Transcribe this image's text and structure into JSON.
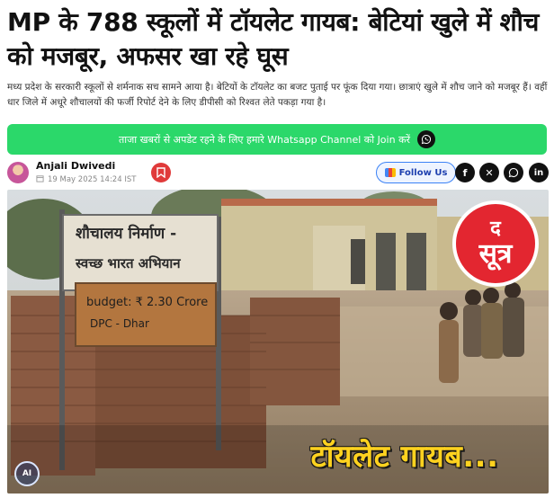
{
  "article": {
    "headline": "MP के 788 स्कूलों में टॉयलेट गायब: बेटियां खुले में शौच को मजबूर, अफसर खा रहे घूस",
    "summary": "मध्य प्रदेश के सरकारी स्कूलों से शर्मनाक सच सामने आया है। बेटियों के टॉयलेट का बजट पुताई पर फूंक दिया गया। छात्राएं खुले में शौच जाने को मजबूर हैं। वहीं धार जिले में अधूरे शौचालयों की फर्जी रिपोर्ट देने के लिए डीपीसी को रिश्वत लेते पकड़ा गया है।"
  },
  "whatsapp_banner": {
    "label": "ताजा खबरों से अपडेट रहने के लिए हमारे Whatsapp Channel को Join करें",
    "icon": "whatsapp-icon",
    "color": "#2bd86a"
  },
  "byline": {
    "author": "Anjali Dwivedi",
    "date": "19 May 2025 14:24 IST",
    "follow_label": "Follow Us",
    "social": [
      "facebook-icon",
      "x-icon",
      "whatsapp-icon",
      "linkedin-icon"
    ]
  },
  "hero": {
    "sign_line1": "शौचालय निर्माण -",
    "sign_line2": "स्वच्छ भारत अभियान",
    "sign_line3": "budget: ₹ 2.30 Crore",
    "sign_line4": "DPC - Dhar",
    "overlay": "टॉयलेट गायब...",
    "logo_line1": "द",
    "logo_line2": "सूत्र",
    "ai_badge": "AI"
  },
  "colors": {
    "brand_red": "#e32630",
    "overlay_yellow": "#ffd21f"
  }
}
